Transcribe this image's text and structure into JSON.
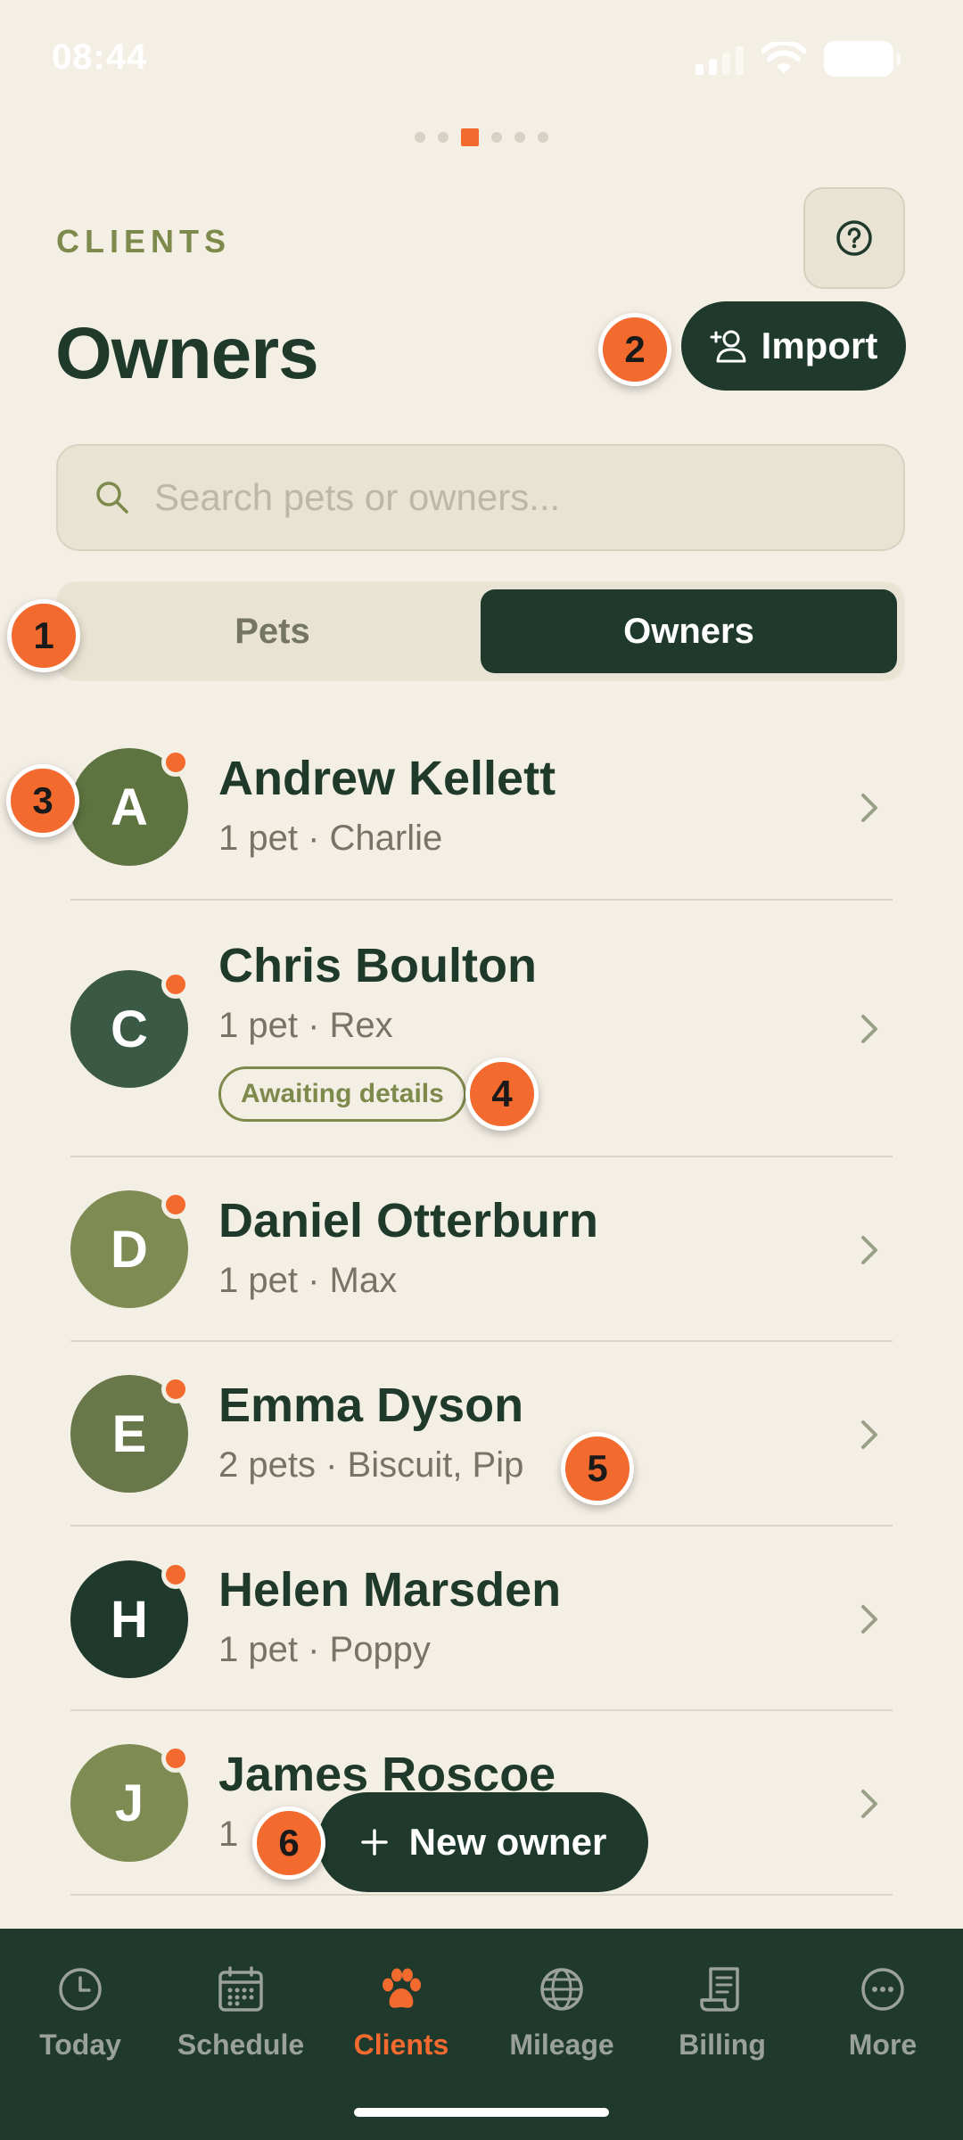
{
  "status_bar": {
    "time": "08:44"
  },
  "header": {
    "section_label": "CLIENTS",
    "title": "Owners",
    "import_label": "Import"
  },
  "search": {
    "placeholder": "Search pets or owners..."
  },
  "segments": [
    {
      "label": "Pets",
      "active": false
    },
    {
      "label": "Owners",
      "active": true
    }
  ],
  "owners": [
    {
      "initial": "A",
      "name": "Andrew Kellett",
      "pets": "1 pet · Charlie",
      "avatar_color": "#5d7440",
      "badge": ""
    },
    {
      "initial": "C",
      "name": "Chris Boulton",
      "pets": "1 pet · Rex",
      "avatar_color": "#3b5a46",
      "badge": "Awaiting details"
    },
    {
      "initial": "D",
      "name": "Daniel Otterburn",
      "pets": "1 pet · Max",
      "avatar_color": "#7e8c54",
      "badge": ""
    },
    {
      "initial": "E",
      "name": "Emma Dyson",
      "pets": "2 pets · Biscuit, Pip",
      "avatar_color": "#68784a",
      "badge": ""
    },
    {
      "initial": "H",
      "name": "Helen Marsden",
      "pets": "1 pet · Poppy",
      "avatar_color": "#1f3a2d",
      "badge": ""
    },
    {
      "initial": "J",
      "name": "James Roscoe",
      "pets": "1",
      "avatar_color": "#7e8c54",
      "badge": ""
    }
  ],
  "fab": {
    "label": "New owner"
  },
  "tabs": [
    {
      "label": "Today",
      "icon": "clock-icon",
      "active": false
    },
    {
      "label": "Schedule",
      "icon": "calendar-icon",
      "active": false
    },
    {
      "label": "Clients",
      "icon": "paw-icon",
      "active": true
    },
    {
      "label": "Mileage",
      "icon": "globe-icon",
      "active": false
    },
    {
      "label": "Billing",
      "icon": "receipt-icon",
      "active": false
    },
    {
      "label": "More",
      "icon": "more-icon",
      "active": false
    }
  ],
  "markers": [
    "1",
    "2",
    "3",
    "4",
    "5",
    "6"
  ],
  "colors": {
    "accent": "#f26a2e",
    "primary": "#1f3a2d",
    "background": "#f4efe5",
    "olive": "#7d8a4c"
  }
}
